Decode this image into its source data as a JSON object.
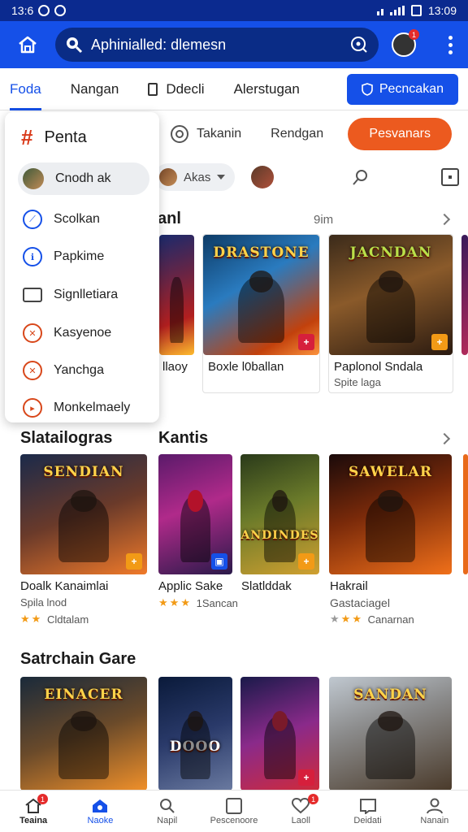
{
  "status_bar": {
    "left_time": "13:6",
    "right_time": "13:09"
  },
  "header": {
    "search_text": "Aphinialled: dlemesn",
    "avatar_badge": "1"
  },
  "tabs": [
    {
      "label": "Foda",
      "active": true
    },
    {
      "label": "Nangan"
    },
    {
      "label": "Ddecli"
    },
    {
      "label": "Alerstugan"
    }
  ],
  "tabs_cta": "Pecncakan",
  "subtabs": {
    "item1": "Takanin",
    "item2": "Rendgan",
    "cta": "Pesvanars"
  },
  "filter": {
    "chip_label": "Akas"
  },
  "drawer": {
    "title": "Penta",
    "items": [
      {
        "label": "Cnodh ak",
        "icon": "avatar",
        "selected": true
      },
      {
        "label": "Scolkan",
        "icon": "compass-icon"
      },
      {
        "label": "Papkime",
        "icon": "info-icon"
      },
      {
        "label": "Signlletiara",
        "icon": "window-icon"
      },
      {
        "label": "Kasyenoe",
        "icon": "swords-icon"
      },
      {
        "label": "Yanchga",
        "icon": "swords-icon"
      },
      {
        "label": "Monkelmaely",
        "icon": "play-icon"
      }
    ]
  },
  "section1": {
    "title": "anl",
    "meta": "9im",
    "cards": [
      {
        "name": "llaoy",
        "art_title": ""
      },
      {
        "name": "Boxle l0ballan",
        "art_title": "DRASTONE"
      },
      {
        "name": "Paplonol Sndala",
        "sub": "Spite laga",
        "art_title": "JACNDAN"
      }
    ]
  },
  "section2": {
    "title_left": "Slatailogras",
    "title_right": "Kantis",
    "cards": [
      {
        "name": "Doalk Kanaimlai",
        "sub": "Spila lnod",
        "rating_text": "Cldtalam",
        "art_title": "SENDIAN"
      },
      {
        "name": "Applic Sake",
        "rating_text": "1Sancan",
        "art_title": ""
      },
      {
        "name": "Slatlddak",
        "art_title": "ANDINDES"
      },
      {
        "name": "Hakrail",
        "sub": "Gastaciagel",
        "rating_text": "Canarnan",
        "art_title": "SAWELAR"
      }
    ]
  },
  "section3": {
    "title": "Satrchain Gare",
    "cards": [
      {
        "art_title": "EINACER"
      },
      {
        "art_title": "DOOO"
      },
      {
        "art_title": ""
      },
      {
        "art_title": "SANDAN"
      }
    ]
  },
  "bottom_nav": [
    {
      "label": "Teaina",
      "icon": "home-icon",
      "badge": "1"
    },
    {
      "label": "Naoke",
      "icon": "bookmark-home-icon",
      "active": true
    },
    {
      "label": "Napil",
      "icon": "search-icon"
    },
    {
      "label": "Pescenoore",
      "icon": "square-icon"
    },
    {
      "label": "Laoll",
      "icon": "heart-icon",
      "badge": "1"
    },
    {
      "label": "Deidati",
      "icon": "book-icon"
    },
    {
      "label": "Nanain",
      "icon": "user-icon"
    }
  ],
  "colors": {
    "primary": "#1550e8",
    "status_bar": "#0b2a8f",
    "accent_orange": "#ec5a1f"
  }
}
